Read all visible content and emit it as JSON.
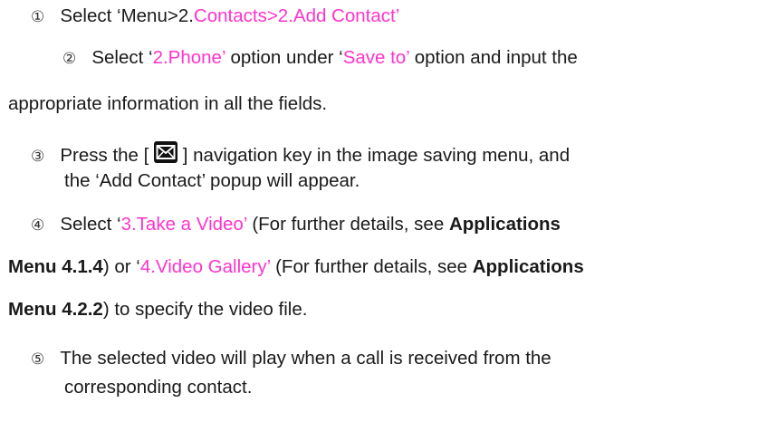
{
  "steps": {
    "s1": {
      "num": "①",
      "t1": "Select ‘Menu>2.",
      "t2": "Contacts>2.Add Contact’"
    },
    "s2": {
      "num": "②",
      "t1": "Select ‘",
      "t2": "2.Phone’",
      "t3": " option under ‘",
      "t4": "Save to’",
      "t5": " option and input the",
      "t6": "appropriate information in all the fields."
    },
    "s3": {
      "num": "③",
      "t1": "Press the [",
      "t2": "] navigation key in the image saving menu, and",
      "t3": "the ‘Add Contact’ popup will appear.",
      "icon": "envelope-icon"
    },
    "s4": {
      "num": "④",
      "t1": "Select ‘",
      "t2": "3.Take a Video’",
      "t3": " (For further details, see ",
      "t4": "Applications",
      "t5": "Menu 4.1.4",
      "t6": ") or ‘",
      "t7": "4.Video Gallery’",
      "t8": " (For further details, see ",
      "t9": "Applications",
      "t10": "Menu 4.2.2",
      "t11": ") to specify the video file."
    },
    "s5": {
      "num": "⑤",
      "t1": "The selected video will play when a call is received from the",
      "t2": "corresponding contact."
    }
  },
  "colors": {
    "highlight": "#ff33cc",
    "text": "#1a1a1a"
  }
}
